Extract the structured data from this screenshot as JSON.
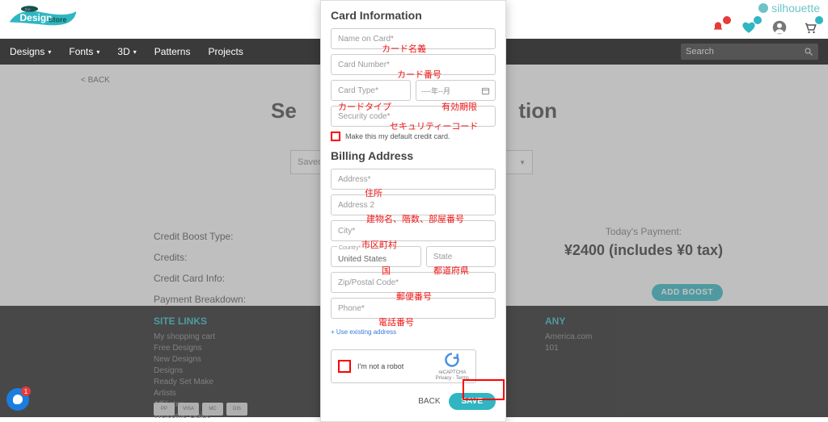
{
  "brand_right": "silhouette",
  "nav": {
    "items": [
      "Designs",
      "Fonts",
      "3D",
      "Patterns",
      "Projects"
    ],
    "search_placeholder": "Search"
  },
  "page": {
    "back": "< BACK",
    "title_left": "Se",
    "title_right": "tion",
    "saved_label": "Saved C",
    "rows": {
      "boost_type": "Credit Boost Type:",
      "credits": "Credits:",
      "cc_info": "Credit Card Info:",
      "breakdown": "Payment Breakdown:"
    },
    "payment": {
      "today_label": "Today's Payment:",
      "amount": "¥2400 (includes ¥0 tax)"
    },
    "add_boost": "ADD BOOST"
  },
  "footer": {
    "links_title": "SITE LINKS",
    "links": [
      "My shopping cart",
      "Free Designs",
      "New Designs",
      "Designs",
      "Ready Set Make",
      "Artists",
      "Affiliates",
      "Welcome Guide"
    ],
    "any_title": "ANY",
    "any_lines": [
      "America.com",
      "101"
    ]
  },
  "modal": {
    "card_info": "Card Information",
    "name_on_card": "Name on Card*",
    "card_number": "Card Number*",
    "card_type": "Card Type*",
    "expiry": "----年--月",
    "security": "Security code*",
    "default_cb": "Make this my default credit card.",
    "billing": "Billing Address",
    "address": "Address*",
    "address2": "Address 2",
    "city": "City*",
    "country_label": "Country*",
    "country_value": "United States",
    "state": "State",
    "zip": "Zip/Postal Code*",
    "phone": "Phone*",
    "use_existing": "+ Use existing address",
    "captcha": "I'm not a robot",
    "captcha_brand": "reCAPTCHA",
    "captcha_terms": "Privacy - Terms",
    "back": "BACK",
    "save": "SAVE"
  },
  "anno": {
    "name": "カード名義",
    "number": "カード番号",
    "type": "カードタイプ",
    "expiry": "有効期限",
    "security": "セキュリティーコード",
    "address": "住所",
    "address2": "建物名、階数、部屋番号",
    "city": "市区町村",
    "country": "国",
    "state": "都道府県",
    "zip": "郵便番号",
    "phone": "電話番号"
  },
  "chat_badge": "1"
}
